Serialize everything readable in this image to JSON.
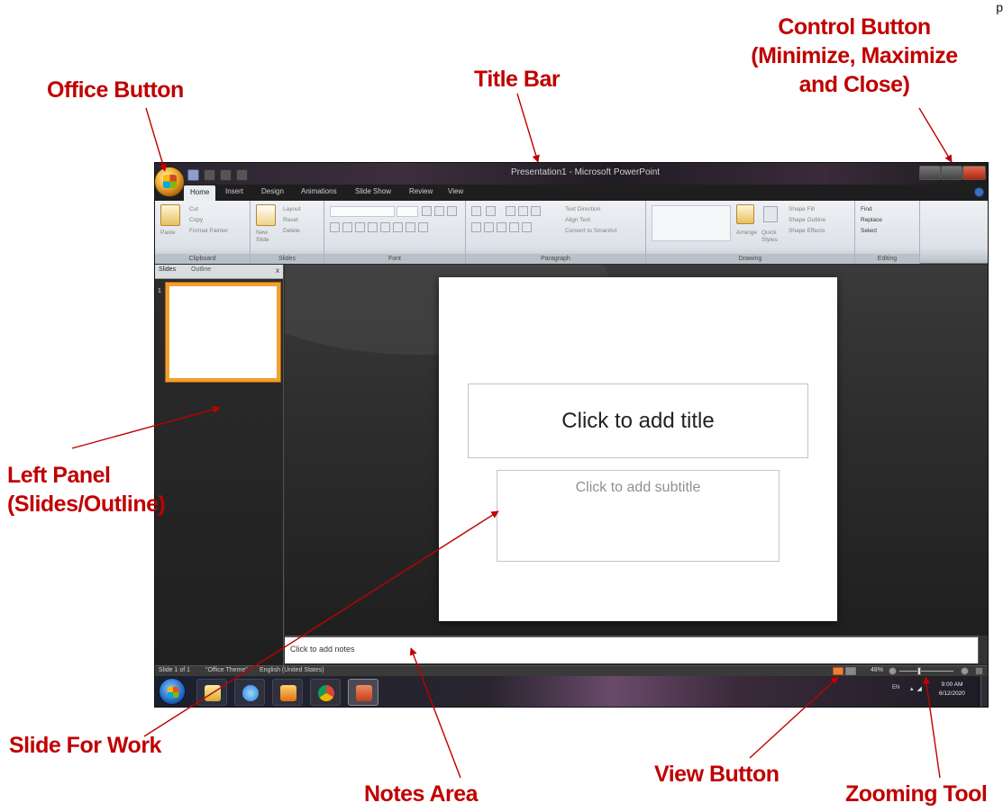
{
  "annotations": {
    "office_button": "Office Button",
    "title_bar": "Title Bar",
    "control_button": [
      "Control Button",
      "(Minimize, Maximize",
      "and Close)"
    ],
    "left_panel": [
      "Left Panel",
      "(Slides/Outline)"
    ],
    "slide_for_work": "Slide For Work",
    "notes_area": "Notes Area",
    "view_button": "View Button",
    "zooming_tool": "Zooming Tool",
    "page_corner": "p"
  },
  "window": {
    "title": "Presentation1 - Microsoft PowerPoint",
    "ribbon_tabs": [
      "Home",
      "Insert",
      "Design",
      "Animations",
      "Slide Show",
      "Review",
      "View"
    ],
    "active_tab": "Home",
    "groups": {
      "clipboard": {
        "label": "Clipboard",
        "paste": "Paste",
        "cut": "Cut",
        "copy": "Copy",
        "format_painter": "Format Painter"
      },
      "slides": {
        "label": "Slides",
        "new_slide": [
          "New",
          "Slide"
        ],
        "layout": "Layout",
        "reset": "Reset",
        "delete": "Delete"
      },
      "font": {
        "label": "Font"
      },
      "paragraph": {
        "label": "Paragraph",
        "text_direction": "Text Direction",
        "align_text": "Align Text",
        "smartart": "Convert to SmartArt"
      },
      "drawing": {
        "label": "Drawing",
        "arrange": "Arrange",
        "quick_styles": [
          "Quick",
          "Styles"
        ],
        "shape_fill": "Shape Fill",
        "shape_outline": "Shape Outline",
        "shape_effects": "Shape Effects"
      },
      "editing": {
        "label": "Editing",
        "find": "Find",
        "replace": "Replace",
        "select": "Select"
      }
    },
    "panel_tabs": {
      "slides": "Slides",
      "outline": "Outline",
      "close": "x"
    },
    "thumbnail_number": "1",
    "slide": {
      "title_placeholder": "Click to add title",
      "subtitle_placeholder": "Click to add subtitle"
    },
    "notes_placeholder": "Click to add notes",
    "status": {
      "slide_count": "Slide 1 of 1",
      "theme": "\"Office Theme\"",
      "language": "English (United States)",
      "zoom": "48%"
    },
    "tray": {
      "language": "EN",
      "time": "9:00 AM",
      "date": "6/12/2020"
    }
  },
  "colors": {
    "annotation": "#c00000",
    "active_view": "#e8843a",
    "thumbnail_border": "#f0a030"
  }
}
